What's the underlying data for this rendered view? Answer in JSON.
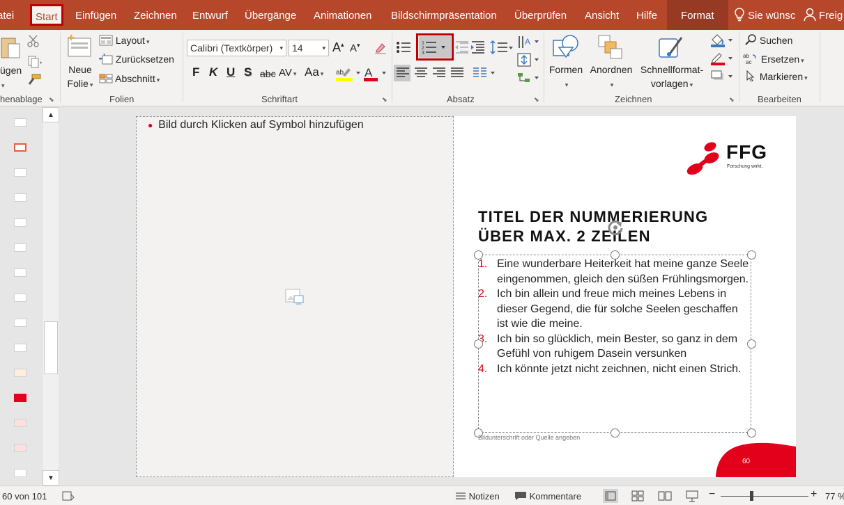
{
  "menu": {
    "tabs": [
      "atei",
      "Start",
      "Einfügen",
      "Zeichnen",
      "Entwurf",
      "Übergänge",
      "Animationen",
      "Bildschirmpräsentation",
      "Überprüfen",
      "Ansicht",
      "Hilfe",
      "Format"
    ],
    "tell_me": "Sie wünsc",
    "share": "Freig"
  },
  "ribbon": {
    "clipboard": {
      "paste_label": "ügen",
      "group_label": "henablage"
    },
    "slides": {
      "new_slide_line1": "Neue",
      "new_slide_line2": "Folie",
      "layout": "Layout",
      "reset": "Zurücksetzen",
      "section": "Abschnitt",
      "group_label": "Folien"
    },
    "font": {
      "font_name": "Calibri (Textkörper)",
      "font_size": "14",
      "bold": "F",
      "italic": "K",
      "underline": "U",
      "shadow": "S",
      "strike": "abc",
      "spacing": "AV",
      "case": "Aa",
      "group_label": "Schriftart"
    },
    "paragraph": {
      "group_label": "Absatz"
    },
    "drawing": {
      "shapes": "Formen",
      "arrange": "Anordnen",
      "quick_styles_line1": "Schnellformat-",
      "quick_styles_line2": "vorlagen",
      "group_label": "Zeichnen"
    },
    "editing": {
      "find": "Suchen",
      "replace": "Ersetzen",
      "select": "Markieren",
      "group_label": "Bearbeiten"
    }
  },
  "slide": {
    "image_placeholder_text": "Bild durch Klicken auf Symbol hinzufügen",
    "logo_text": "FFG",
    "logo_tagline": "Forschung wirkt.",
    "title_line1": "TITEL DER NUMMERIERUNG",
    "title_line2": "ÜBER MAX. 2 ZEILEN",
    "list": [
      {
        "num": "1.",
        "text": "Eine wunderbare Heiterkeit hat meine ganze Seele eingenommen, gleich den süßen Frühlingsmorgen."
      },
      {
        "num": "2.",
        "text": "Ich bin allein und freue mich meines Lebens in dieser Gegend, die für solche Seelen geschaffen ist wie die meine."
      },
      {
        "num": "3.",
        "text": "Ich bin so glücklich, mein Bester, so ganz in dem Gefühl von ruhigem Dasein versunken"
      },
      {
        "num": "4.",
        "text": "Ich könnte jetzt nicht zeichnen, nicht einen Strich."
      }
    ],
    "caption": "Bildunterschrift oder Quelle angeben",
    "page_number": "60"
  },
  "status": {
    "slide_counter": "60 von 101",
    "notes": "Notizen",
    "comments": "Kommentare",
    "zoom": "77 %",
    "zoom_level": 0.35
  },
  "colors": {
    "accent": "#b7472a",
    "brand_red": "#e2001a",
    "highlight": "#c00000"
  }
}
